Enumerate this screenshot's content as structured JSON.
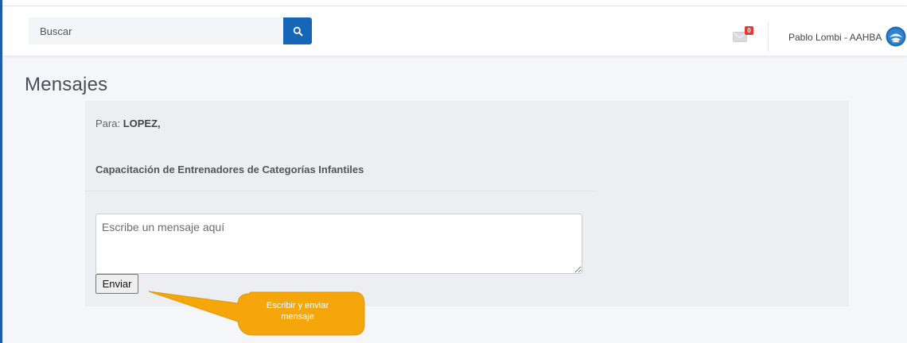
{
  "search": {
    "placeholder": "Buscar"
  },
  "header": {
    "mail_count": "0",
    "user_name": "Pablo Lombi - AAHBA"
  },
  "page": {
    "title": "Mensajes"
  },
  "message": {
    "to_label": "Para:",
    "to_value": "LOPEZ,",
    "subject": "Capacitación de Entrenadores de Categorías Infantiles",
    "placeholder": "Escribe un mensaje aquí",
    "send_label": "Enviar"
  },
  "callout": {
    "line1": "Escribir y enviar",
    "line2": "mensaje"
  },
  "colors": {
    "accent": "#1666b8",
    "badge": "#e53935",
    "callout": "#f5a60a"
  }
}
